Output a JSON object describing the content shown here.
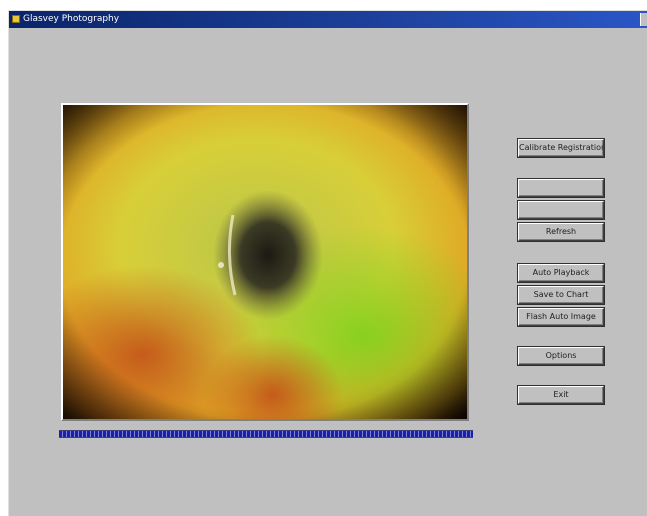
{
  "window": {
    "title": "Glasvey Photography"
  },
  "video": {
    "description_icon": "camera-feed",
    "progress_fraction": 1.0
  },
  "buttons": [
    {
      "key": "calibrate",
      "label": "Calibrate Registration",
      "enabled": true
    },
    {
      "key": "blank1",
      "label": "",
      "enabled": false
    },
    {
      "key": "blank2",
      "label": "",
      "enabled": false
    },
    {
      "key": "refresh",
      "label": "Refresh",
      "enabled": true
    },
    {
      "key": "autoplay",
      "label": "Auto Playback",
      "enabled": true
    },
    {
      "key": "save",
      "label": "Save to Chart",
      "enabled": true
    },
    {
      "key": "flash",
      "label": "Flash Auto Image",
      "enabled": true
    },
    {
      "key": "options",
      "label": "Options",
      "enabled": true
    },
    {
      "key": "exit",
      "label": "Exit",
      "enabled": true
    }
  ],
  "colors": {
    "titlebar": "#0a246a",
    "window_face": "#c0c0c0",
    "progress": "#1e1ea8"
  }
}
